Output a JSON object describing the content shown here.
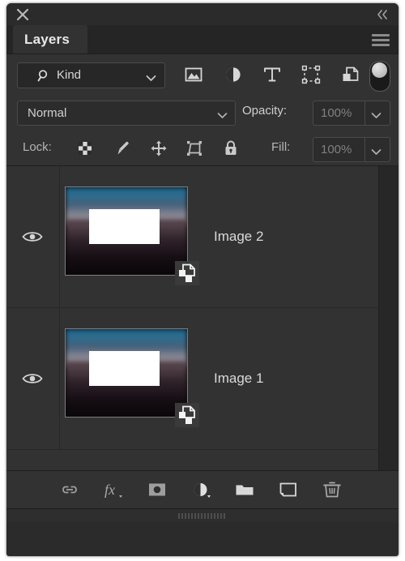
{
  "panel": {
    "close_icon": "close-icon",
    "collapse_icon": "double-chevron-left-icon",
    "tab_label": "Layers",
    "menu_icon": "hamburger-menu-icon"
  },
  "filter": {
    "kind_label": "Kind",
    "search_icon": "search-icon",
    "chevron_icon": "chevron-down-icon",
    "type_icons": [
      {
        "name": "pixel-layer-filter-icon",
        "title": "Pixel Layers"
      },
      {
        "name": "adjustment-layer-filter-icon",
        "title": "Adjustment Layers"
      },
      {
        "name": "type-layer-filter-icon",
        "title": "Type Layers"
      },
      {
        "name": "shape-layer-filter-icon",
        "title": "Shape Layers"
      },
      {
        "name": "smart-object-filter-icon",
        "title": "Smart Objects"
      }
    ],
    "toggle_name": "filter-enable-toggle"
  },
  "blend": {
    "mode": "Normal",
    "opacity_label": "Opacity:",
    "opacity_value": "100%"
  },
  "lock": {
    "label": "Lock:",
    "icons": [
      {
        "name": "lock-transparent-pixels-icon"
      },
      {
        "name": "lock-image-pixels-icon"
      },
      {
        "name": "lock-position-icon"
      },
      {
        "name": "lock-artboard-nesting-icon"
      },
      {
        "name": "lock-all-icon"
      }
    ],
    "fill_label": "Fill:",
    "fill_value": "100%"
  },
  "layers": [
    {
      "name": "Image 2",
      "visible": true,
      "badge": "smart-object-badge-icon"
    },
    {
      "name": "Image 1",
      "visible": true,
      "badge": "smart-object-badge-icon"
    }
  ],
  "bottom_toolbar": [
    {
      "name": "link-layers-icon"
    },
    {
      "name": "layer-style-fx-icon"
    },
    {
      "name": "add-layer-mask-icon"
    },
    {
      "name": "new-adjustment-layer-icon"
    },
    {
      "name": "new-group-icon"
    },
    {
      "name": "new-layer-icon"
    },
    {
      "name": "delete-layer-icon"
    }
  ],
  "colors": {
    "panel_bg": "#2b2b2b",
    "row_bg": "#323232",
    "tab_bg": "#323232",
    "text": "#d9d9d9",
    "muted_text": "#808080",
    "border": "#4a4a4a"
  }
}
